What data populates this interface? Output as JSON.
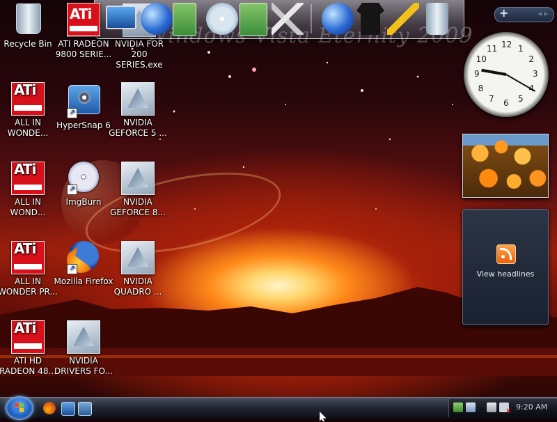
{
  "desktop": {
    "watermark": "Windows Vista Eternity 2009",
    "icons": [
      {
        "label": "Recycle Bin",
        "type": "bin"
      },
      {
        "label": "ATI RADEON 9800 SERIE...",
        "type": "ati"
      },
      {
        "label": "NVIDIA FOR 200 SERIES.exe",
        "type": "nvidia"
      },
      {
        "label": "ALL IN WONDE...",
        "type": "ati"
      },
      {
        "label": "HyperSnap 6",
        "type": "hypersnap"
      },
      {
        "label": "NVIDIA GEFORCE 5 ...",
        "type": "nvidia"
      },
      {
        "label": "ALL IN WOND...",
        "type": "ati"
      },
      {
        "label": "ImgBurn",
        "type": "imgburn"
      },
      {
        "label": "NVIDIA GEFORCE 8...",
        "type": "nvidia"
      },
      {
        "label": "ALL IN WONDER PR...",
        "type": "ati"
      },
      {
        "label": "Mozilla Firefox",
        "type": "firefox"
      },
      {
        "label": "NVIDIA QUADRO ...",
        "type": "nvidia"
      },
      {
        "label": "ATI HD RADEON 48...",
        "type": "ati"
      },
      {
        "label": "NVIDIA DRIVERS FO...",
        "type": "nvidia"
      }
    ]
  },
  "dock": {
    "items": [
      "ati-icon",
      "monitor-icon",
      "network-globe-icon",
      "folder-icon",
      "cd-drive-icon",
      "folder-green-icon",
      "tools-icon",
      "globe-icon",
      "shirt-icon",
      "wrench-icon",
      "recycle-bin-icon"
    ]
  },
  "sidebar": {
    "add_label": "+",
    "nav_arrows": "◂ ▸",
    "clock": {
      "hour": 9,
      "minute": 20,
      "numbers": [
        "12",
        "1",
        "2",
        "3",
        "4",
        "5",
        "6",
        "7",
        "8",
        "9",
        "10",
        "11"
      ]
    },
    "feed_label": "View headlines"
  },
  "taskbar": {
    "clock_text": "9:20 AM"
  },
  "colors": {
    "taskbar": "#232833",
    "sidebar_gadget": "#2c3546",
    "ati_red": "#d8101a"
  }
}
